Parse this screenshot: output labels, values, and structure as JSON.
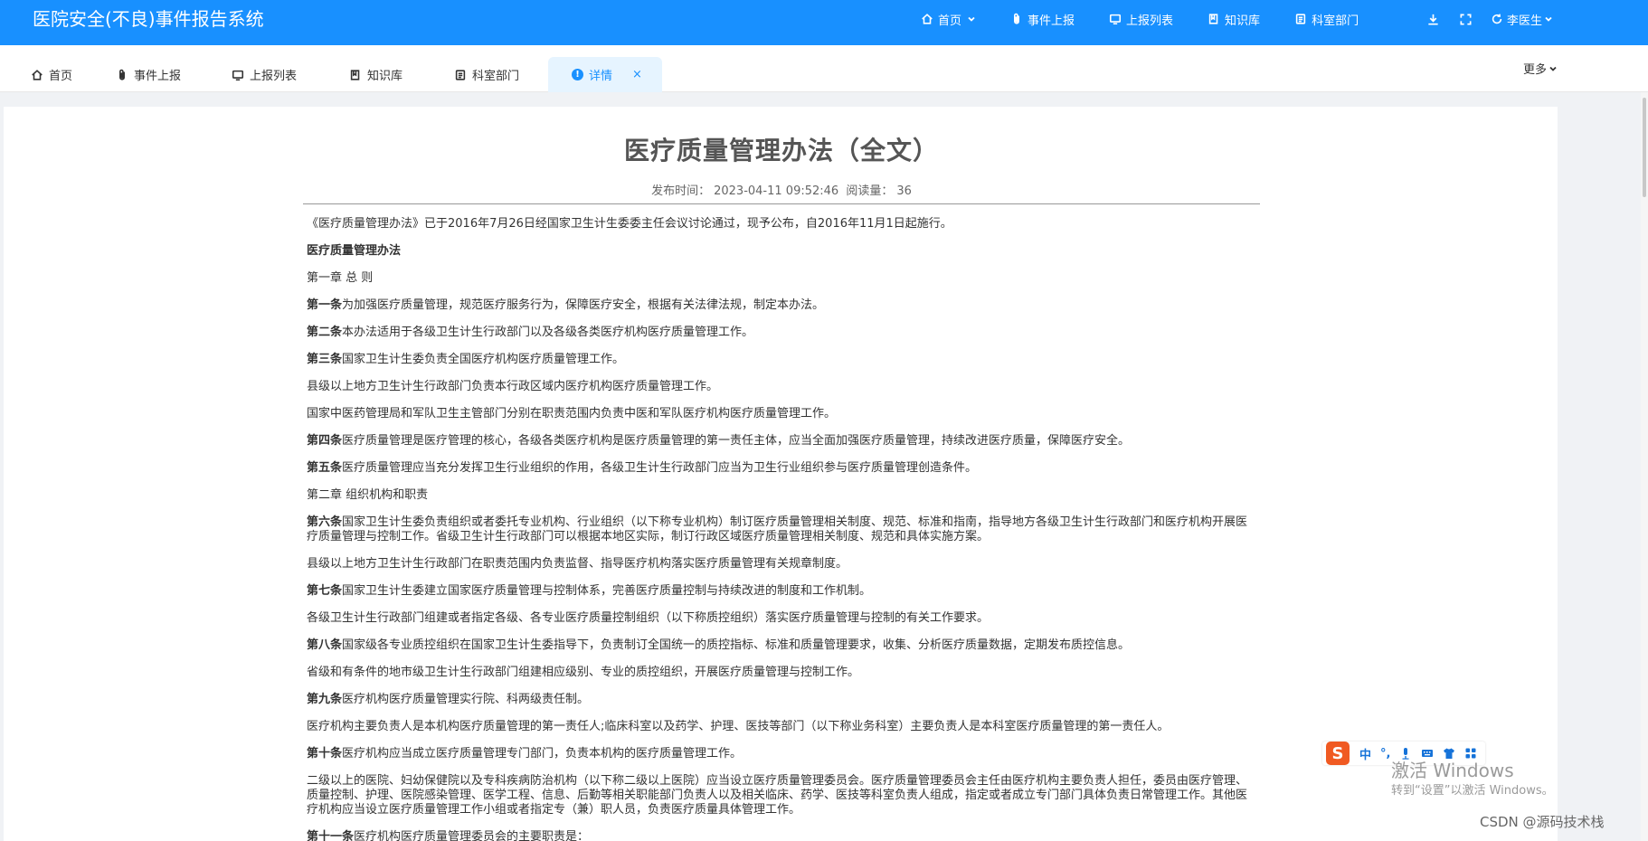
{
  "header": {
    "title": "医院安全(不良)事件报告系统",
    "nav": [
      {
        "label": "首页",
        "icon": "home-icon"
      },
      {
        "label": "事件上报",
        "icon": "paperclip-icon"
      },
      {
        "label": "上报列表",
        "icon": "monitor-icon"
      },
      {
        "label": "知识库",
        "icon": "book-icon"
      },
      {
        "label": "科室部门",
        "icon": "clipboard-icon"
      }
    ],
    "user": "李医生"
  },
  "tabs": [
    {
      "label": "首页",
      "icon": "home-icon"
    },
    {
      "label": "事件上报",
      "icon": "paperclip-icon"
    },
    {
      "label": "上报列表",
      "icon": "monitor-icon"
    },
    {
      "label": "知识库",
      "icon": "book-icon"
    },
    {
      "label": "科室部门",
      "icon": "clipboard-icon"
    },
    {
      "label": "详情",
      "icon": "info-icon",
      "active": true,
      "close": "×"
    }
  ],
  "more_label": "更多",
  "article": {
    "title": "医疗质量管理办法（全文）",
    "publish_label": "发布时间：",
    "publish_time": "2023-04-11 09:52:46",
    "views_label": "阅读量：",
    "views": "36",
    "paragraphs": [
      {
        "lead": "",
        "text": "《医疗质量管理办法》已于2016年7月26日经国家卫生计生委委主任会议讨论通过，现予公布，自2016年11月1日起施行。"
      },
      {
        "lead": "医疗质量管理办法",
        "text": ""
      },
      {
        "lead": "",
        "text": "第一章 总 则"
      },
      {
        "lead": "第一条",
        "text": "为加强医疗质量管理，规范医疗服务行为，保障医疗安全，根据有关法律法规，制定本办法。"
      },
      {
        "lead": "第二条",
        "text": "本办法适用于各级卫生计生行政部门以及各级各类医疗机构医疗质量管理工作。"
      },
      {
        "lead": "第三条",
        "text": "国家卫生计生委负责全国医疗机构医疗质量管理工作。"
      },
      {
        "lead": "",
        "text": "县级以上地方卫生计生行政部门负责本行政区域内医疗机构医疗质量管理工作。"
      },
      {
        "lead": "",
        "text": "国家中医药管理局和军队卫生主管部门分别在职责范围内负责中医和军队医疗机构医疗质量管理工作。"
      },
      {
        "lead": "第四条",
        "text": "医疗质量管理是医疗管理的核心，各级各类医疗机构是医疗质量管理的第一责任主体，应当全面加强医疗质量管理，持续改进医疗质量，保障医疗安全。"
      },
      {
        "lead": "第五条",
        "text": "医疗质量管理应当充分发挥卫生行业组织的作用，各级卫生计生行政部门应当为卫生行业组织参与医疗质量管理创造条件。"
      },
      {
        "lead": "",
        "text": "第二章 组织机构和职责"
      },
      {
        "lead": "第六条",
        "text": "国家卫生计生委负责组织或者委托专业机构、行业组织（以下称专业机构）制订医疗质量管理相关制度、规范、标准和指南，指导地方各级卫生计生行政部门和医疗机构开展医疗质量管理与控制工作。省级卫生计生行政部门可以根据本地区实际，制订行政区域医疗质量管理相关制度、规范和具体实施方案。"
      },
      {
        "lead": "",
        "text": "县级以上地方卫生计生行政部门在职责范围内负责监督、指导医疗机构落实医疗质量管理有关规章制度。"
      },
      {
        "lead": "第七条",
        "text": "国家卫生计生委建立国家医疗质量管理与控制体系，完善医疗质量控制与持续改进的制度和工作机制。"
      },
      {
        "lead": "",
        "text": "各级卫生计生行政部门组建或者指定各级、各专业医疗质量控制组织（以下称质控组织）落实医疗质量管理与控制的有关工作要求。"
      },
      {
        "lead": "第八条",
        "text": "国家级各专业质控组织在国家卫生计生委指导下，负责制订全国统一的质控指标、标准和质量管理要求，收集、分析医疗质量数据，定期发布质控信息。"
      },
      {
        "lead": "",
        "text": "省级和有条件的地市级卫生计生行政部门组建相应级别、专业的质控组织，开展医疗质量管理与控制工作。"
      },
      {
        "lead": "第九条",
        "text": "医疗机构医疗质量管理实行院、科两级责任制。"
      },
      {
        "lead": "",
        "text": "医疗机构主要负责人是本机构医疗质量管理的第一责任人;临床科室以及药学、护理、医技等部门（以下称业务科室）主要负责人是本科室医疗质量管理的第一责任人。"
      },
      {
        "lead": "第十条",
        "text": "医疗机构应当成立医疗质量管理专门部门，负责本机构的医疗质量管理工作。"
      },
      {
        "lead": "",
        "text": "二级以上的医院、妇幼保健院以及专科疾病防治机构（以下称二级以上医院）应当设立医疗质量管理委员会。医疗质量管理委员会主任由医疗机构主要负责人担任，委员由医疗管理、质量控制、护理、医院感染管理、医学工程、信息、后勤等相关职能部门负责人以及相关临床、药学、医技等科室负责人组成，指定或者成立专门部门具体负责日常管理工作。其他医疗机构应当设立医疗质量管理工作小组或者指定专（兼）职人员，负责医疗质量具体管理工作。"
      },
      {
        "lead": "第十一条",
        "text": "医疗机构医疗质量管理委员会的主要职责是："
      }
    ]
  },
  "ime": {
    "items": [
      "中",
      "°,"
    ]
  },
  "watermark": {
    "line1": "激活 Windows",
    "line2": "转到“设置”以激活 Windows。"
  },
  "csdn": "CSDN @源码技术栈"
}
